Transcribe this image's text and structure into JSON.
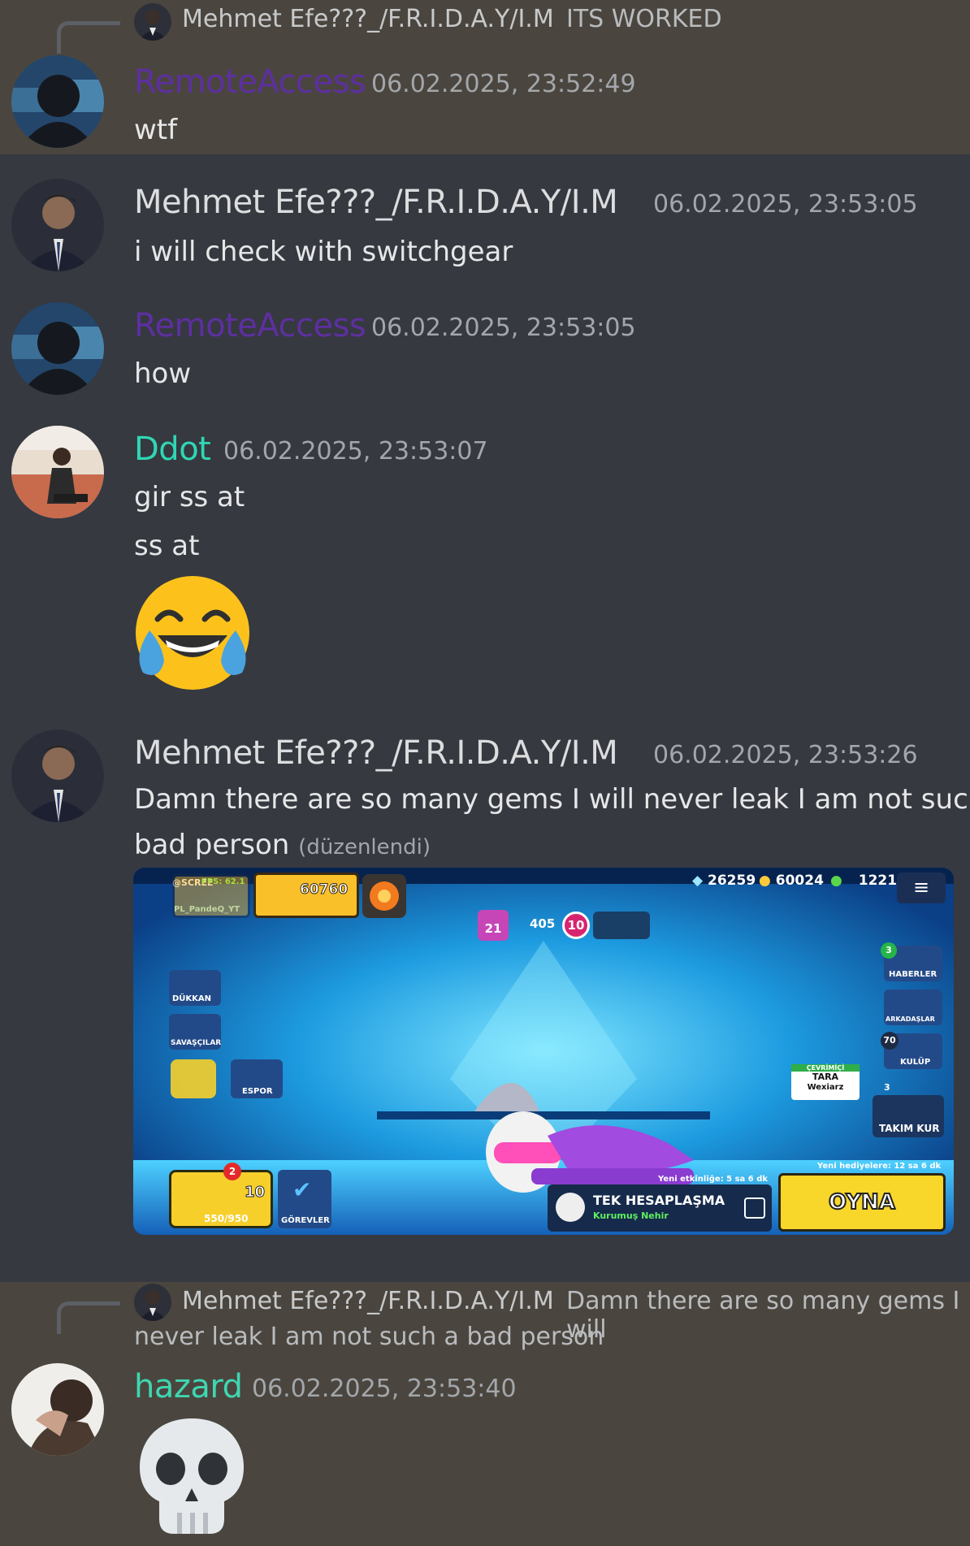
{
  "colors": {
    "background": "#363940",
    "highlight": "#4a463f",
    "remote_name": "#5d2fa0",
    "ddot_name": "#2fd7b4",
    "hazard_name": "#3fd6b0"
  },
  "messages": [
    {
      "reply": {
        "author": "Mehmet Efe???_/F.R.I.D.A.Y/I.M",
        "text": "ITS WORKED"
      },
      "author": "RemoteAccess",
      "timestamp": "06.02.2025, 23:52:49",
      "lines": [
        "wtf"
      ]
    },
    {
      "author": "Mehmet Efe???_/F.R.I.D.A.Y/I.M",
      "timestamp": "06.02.2025, 23:53:05",
      "lines": [
        "i will check with switchgear"
      ]
    },
    {
      "author": "RemoteAccess",
      "timestamp": "06.02.2025, 23:53:05",
      "lines": [
        "how"
      ]
    },
    {
      "author": "Ddot",
      "timestamp": "06.02.2025, 23:53:07",
      "lines": [
        "gir ss at",
        "ss at"
      ],
      "emoji": "joy-emoji"
    },
    {
      "author": "Mehmet Efe???_/F.R.I.D.A.Y/I.M",
      "timestamp": "06.02.2025, 23:53:26",
      "lines": [
        "Damn there are so many gems I will never leak I am not such a",
        "bad person"
      ],
      "edited": "(düzenlendi)",
      "attachment": {
        "game_stats": {
          "gems": "26259",
          "coins": "60024",
          "points": "1221",
          "trophies": "60760",
          "fps": "FPS: 62.1",
          "player": "PL_PandeQ_YT",
          "streamer": "@SCREE"
        },
        "rank": {
          "tier": "21",
          "trophies": "405",
          "level": "10"
        },
        "left_menu": [
          "DÜKKAN",
          "SAVAŞÇILAR",
          "ESPOR"
        ],
        "right_menu": [
          {
            "label": "HABERLER",
            "badge": "3"
          },
          {
            "label": "ARKADAŞLAR",
            "badge": ""
          },
          {
            "label": "KULÜP",
            "badge": "70"
          }
        ],
        "friend": {
          "status": "ÇEVRİMİÇİ",
          "name1": "TARA",
          "name2": "Wexiarz",
          "count": "3"
        },
        "team_button": "TAKIM KUR",
        "brawl_pass": {
          "badge": "2",
          "level": "10",
          "progress": "550/950"
        },
        "quests_label": "GÖREVLER",
        "event_timer": "Yeni etkinliğe: 5 sa 6 dk",
        "gift_timer": "Yeni hediyelere: 12 sa 6 dk",
        "mode": "TEK HESAPLAŞMA",
        "map": "Kurumuş Nehir",
        "play_button": "OYNA"
      }
    },
    {
      "reply": {
        "author": "Mehmet Efe???_/F.R.I.D.A.Y/I.M",
        "text": "Damn there are so many gems I will",
        "text2": "never leak I am not such a bad person"
      },
      "author": "hazard",
      "timestamp": "06.02.2025, 23:53:40",
      "emoji": "skull-emoji"
    }
  ]
}
